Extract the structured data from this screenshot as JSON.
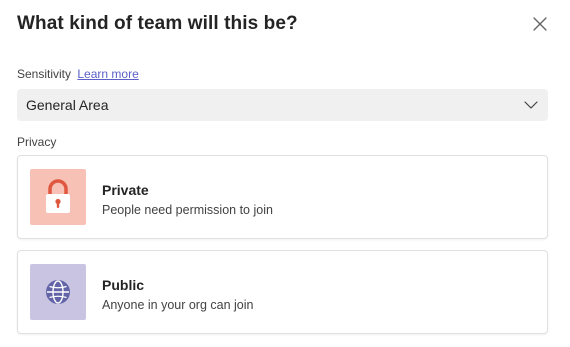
{
  "dialog": {
    "title": "What kind of team will this be?",
    "close_icon": "close-icon"
  },
  "sensitivity": {
    "label": "Sensitivity",
    "link": "Learn more",
    "selected": "General Area",
    "dropdown_icon": "chevron-down-icon"
  },
  "privacy": {
    "label": "Privacy",
    "options": [
      {
        "name": "Private",
        "description": "People need permission to join",
        "icon": "lock-icon",
        "tile_color": "#f7c1b6",
        "icon_color": "#e0573f"
      },
      {
        "name": "Public",
        "description": "Anyone in your org can join",
        "icon": "globe-icon",
        "tile_color": "#c9c4e2",
        "icon_color": "#6264a7"
      }
    ]
  },
  "colors": {
    "link": "#5b5fc7",
    "dropdown_bg": "#f0f0f0"
  }
}
